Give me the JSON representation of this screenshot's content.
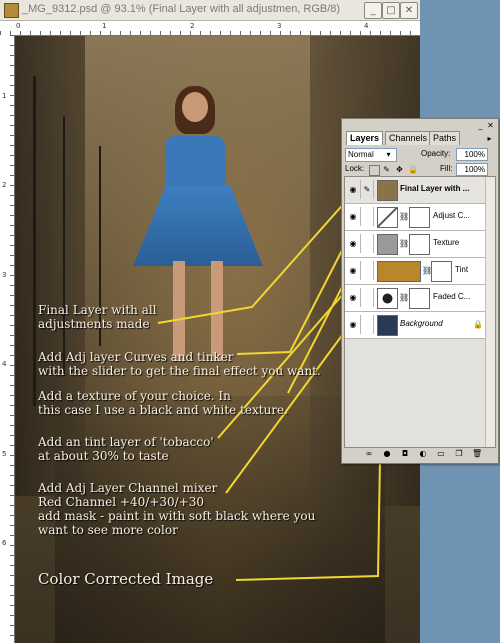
{
  "window": {
    "title": "_MG_9312.psd @ 93.1% (Final Layer with all adjustmen, RGB/8)",
    "minimize": "_",
    "maximize": "□",
    "close": "✕",
    "icon": "photoshop-doc-icon"
  },
  "rulers": {
    "top": [
      "0",
      "1",
      "2",
      "3",
      "4"
    ],
    "left": [
      "1",
      "2",
      "3",
      "4",
      "5",
      "6"
    ]
  },
  "callouts": {
    "final_layer": "Final Layer with all\nadjustments made",
    "curves": "Add Adj layer Curves and tinker\nwith the slider to get the final effect you want.",
    "texture": "Add a texture of your choice. In\nthis case I use a black and white texture.",
    "tint": "Add an tint layer of 'tobacco'\nat about 30% to taste",
    "channel_mixer": "Add Adj Layer Channel mixer\nRed Channel +40/+30/+30\nadd mask - paint in with soft black where you\nwant to see more color",
    "color_corrected": "Color Corrected Image"
  },
  "panel": {
    "tabs": [
      "Layers",
      "Channels",
      "Paths"
    ],
    "active_tab": "Layers",
    "blend_mode": "Normal",
    "opacity_label": "Opacity:",
    "opacity": "100%",
    "lock_label": "Lock:",
    "fill_label": "Fill:",
    "fill": "100%",
    "layers": [
      {
        "name": "Final Layer with ...",
        "thumb": "#8a7349"
      },
      {
        "name": "Adjust C...",
        "thumb": "#ffffff"
      },
      {
        "name": "Texture",
        "thumb": "#9a9a9a"
      },
      {
        "name": "Tint",
        "thumb": "#b8862d"
      },
      {
        "name": "Faded C...",
        "thumb": "#ffffff"
      },
      {
        "name": "Background",
        "thumb": "#2a3a55"
      }
    ],
    "bottom_icons": [
      "link-icon",
      "fx-icon",
      "mask-icon",
      "adjustment-icon",
      "folder-icon",
      "new-layer-icon",
      "trash-icon"
    ]
  },
  "colors": {
    "callout_line": "#f2d632",
    "desktop": "#6f93b2"
  }
}
